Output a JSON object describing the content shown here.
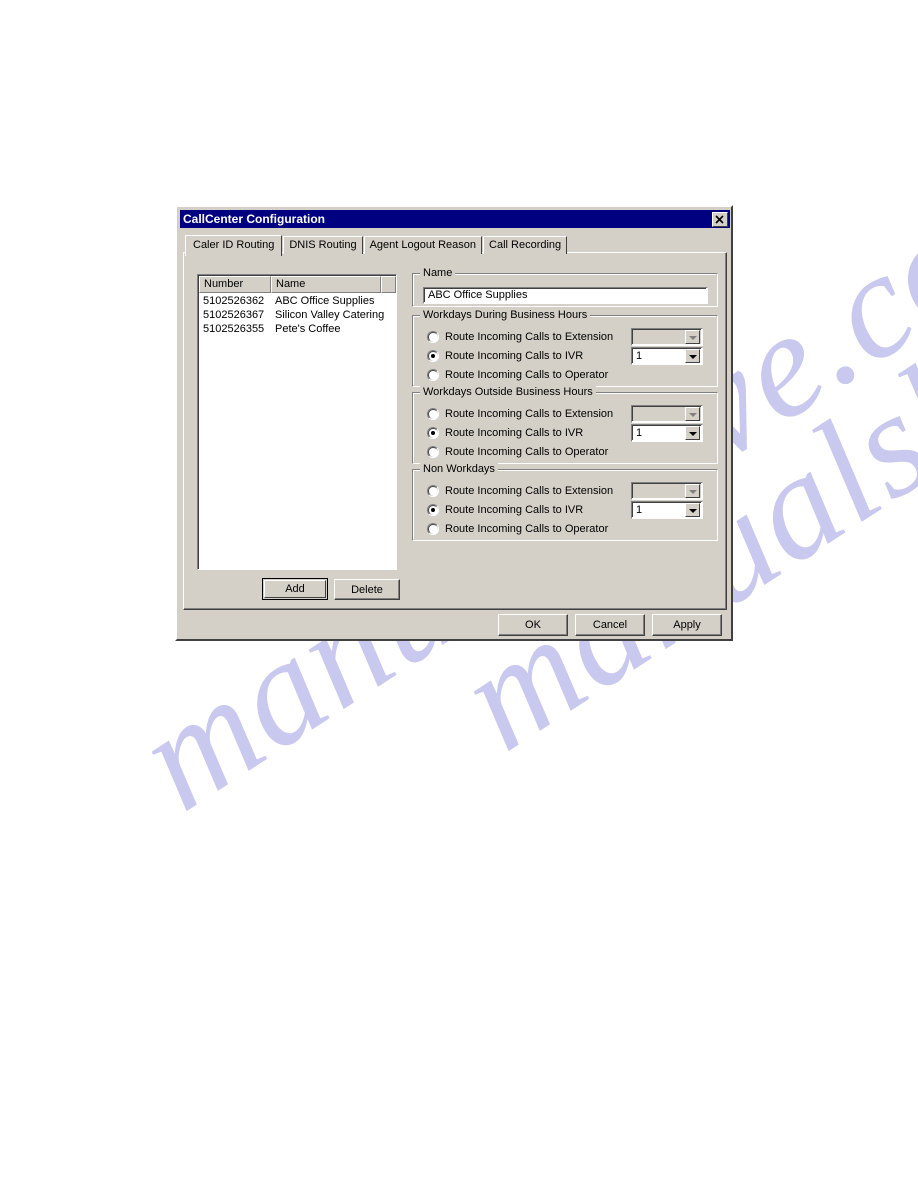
{
  "window": {
    "title": "CallCenter Configuration",
    "close_icon": "close-x-icon"
  },
  "tabs": [
    {
      "label": "Caler ID Routing",
      "active": true
    },
    {
      "label": "DNIS Routing",
      "active": false
    },
    {
      "label": "Agent Logout Reason",
      "active": false
    },
    {
      "label": "Call Recording",
      "active": false
    }
  ],
  "listview": {
    "columns": [
      "Number",
      "Name"
    ],
    "rows": [
      {
        "number": "5102526362",
        "name": "ABC Office Supplies"
      },
      {
        "number": "5102526367",
        "name": "Silicon Valley Catering"
      },
      {
        "number": "5102526355",
        "name": "Pete's Coffee"
      }
    ]
  },
  "list_buttons": {
    "add": "Add",
    "delete": "Delete"
  },
  "name_group": {
    "title": "Name",
    "value": "ABC Office Supplies",
    "placeholder": ""
  },
  "groups": [
    {
      "id": "workdays-during-business-hours",
      "title": "Workdays During Business Hours",
      "options": [
        {
          "label": "Route Incoming Calls to Extension",
          "checked": false
        },
        {
          "label": "Route Incoming Calls to IVR",
          "checked": true
        },
        {
          "label": "Route Incoming Calls to Operator",
          "checked": false
        }
      ],
      "extension_combo": {
        "value": "",
        "enabled": false
      },
      "ivr_combo": {
        "value": "1",
        "enabled": true
      }
    },
    {
      "id": "workdays-outside-business-hours",
      "title": "Workdays Outside Business Hours",
      "options": [
        {
          "label": "Route Incoming Calls to Extension",
          "checked": false
        },
        {
          "label": "Route Incoming Calls to IVR",
          "checked": true
        },
        {
          "label": "Route Incoming Calls to Operator",
          "checked": false
        }
      ],
      "extension_combo": {
        "value": "",
        "enabled": false
      },
      "ivr_combo": {
        "value": "1",
        "enabled": true
      }
    },
    {
      "id": "non-workdays",
      "title": "Non Workdays",
      "options": [
        {
          "label": "Route Incoming Calls to Extension",
          "checked": false
        },
        {
          "label": "Route Incoming Calls to IVR",
          "checked": true
        },
        {
          "label": "Route Incoming Calls to Operator",
          "checked": false
        }
      ],
      "extension_combo": {
        "value": "",
        "enabled": false
      },
      "ivr_combo": {
        "value": "1",
        "enabled": true
      }
    }
  ],
  "dialog_buttons": {
    "ok": "OK",
    "cancel": "Cancel",
    "apply": "Apply"
  },
  "watermark": {
    "text_1": "manualshive.com",
    "text_2": "manualshive.com",
    "color": "#c9c8ef"
  },
  "colors": {
    "titlebar": "#000080",
    "face": "#d4d0c8",
    "shadow": "#808080",
    "dark": "#404040",
    "light": "#ffffff",
    "field": "#ffffff"
  }
}
